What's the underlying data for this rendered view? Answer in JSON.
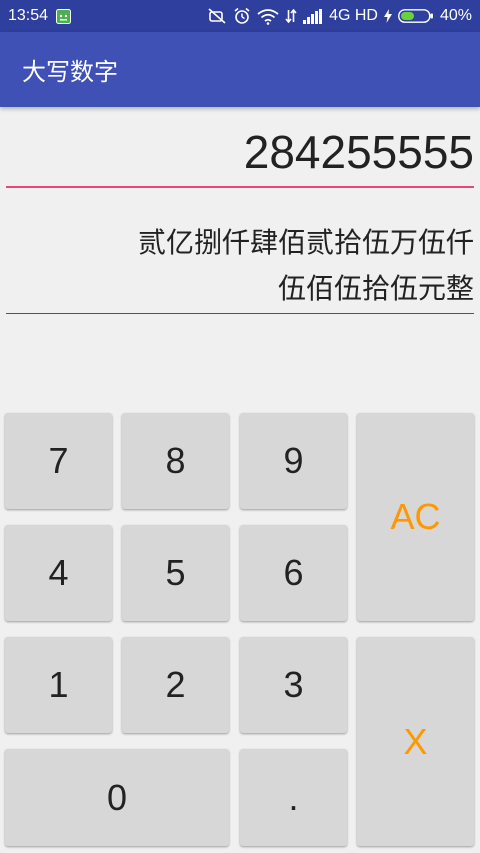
{
  "status_bar": {
    "time": "13:54",
    "network": "4G HD",
    "battery": "40%"
  },
  "app_bar": {
    "title": "大写数字"
  },
  "input": {
    "value": "284255555"
  },
  "result": {
    "line1": "贰亿捌仟肆佰贰拾伍万伍仟",
    "line2": "伍佰伍拾伍元整"
  },
  "keypad": {
    "k7": "7",
    "k8": "8",
    "k9": "9",
    "k4": "4",
    "k5": "5",
    "k6": "6",
    "k1": "1",
    "k2": "2",
    "k3": "3",
    "k0": "0",
    "dot": ".",
    "clear": "AC",
    "delete": "X"
  },
  "colors": {
    "primary": "#3f51b5",
    "primary_dark": "#2f3f9d",
    "accent_pink": "#e5467d",
    "key_accent": "#ff9800",
    "key_bg": "#d7d7d7",
    "background": "#f0f0f0"
  },
  "icons": {
    "notification": "android-notification-icon",
    "mute": "mute-icon",
    "alarm": "alarm-icon",
    "wifi": "wifi-icon",
    "data": "data-transfer-icon",
    "signal": "signal-icon",
    "charging": "charging-icon",
    "battery": "battery-icon"
  }
}
